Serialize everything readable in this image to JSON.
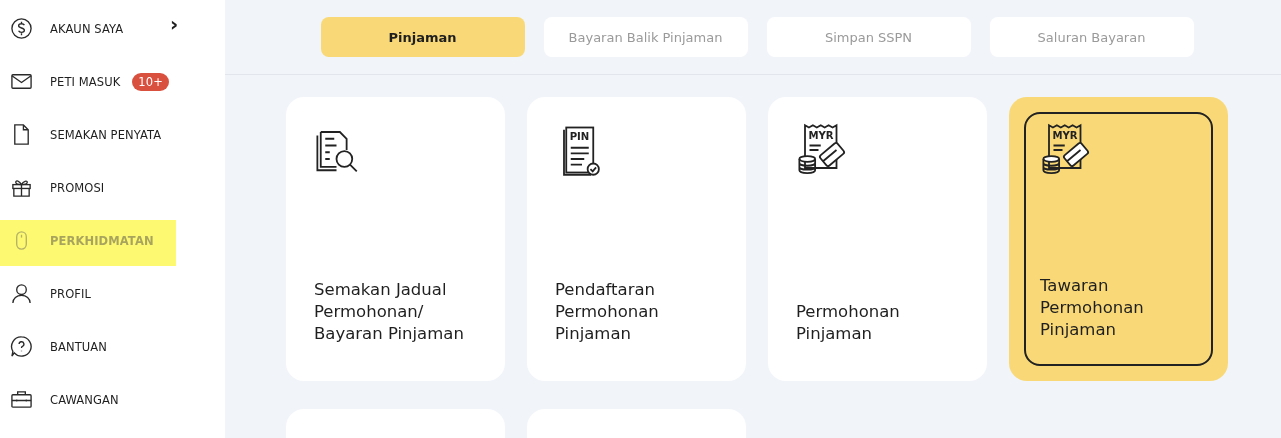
{
  "sidebar": {
    "items": [
      {
        "kind": "dollar",
        "label": "AKAUN SAYA",
        "chevron": "›",
        "selected": false
      },
      {
        "kind": "mail",
        "label": "PETI MASUK",
        "badge": "10+",
        "selected": false
      },
      {
        "kind": "document",
        "label": "SEMAKAN PENYATA",
        "selected": false
      },
      {
        "kind": "gift",
        "label": "PROMOSI",
        "selected": false
      },
      {
        "kind": "mouse",
        "label": "PERKHIDMATAN",
        "selected": true
      },
      {
        "kind": "person",
        "label": "PROFIL",
        "selected": false
      },
      {
        "kind": "help",
        "label": "BANTUAN",
        "selected": false
      },
      {
        "kind": "briefcase",
        "label": "CAWANGAN",
        "selected": false
      }
    ]
  },
  "tabs": [
    {
      "label": "Pinjaman",
      "selected": true
    },
    {
      "label": "Bayaran Balik Pinjaman",
      "selected": false
    },
    {
      "label": "Simpan SSPN",
      "selected": false
    },
    {
      "label": "Saluran Bayaran",
      "selected": false
    }
  ],
  "cards": [
    {
      "kind": "search-document",
      "title": "Semakan Jadual Permohonan/ Bayaran Pinjaman",
      "selected": false
    },
    {
      "kind": "pin-document",
      "icon_text": "PIN",
      "title": "Pendaftaran Permohonan Pinjaman",
      "selected": false
    },
    {
      "kind": "receipt",
      "icon_text": "MYR",
      "title": "Permohonan Pinjaman",
      "selected": false
    },
    {
      "kind": "receipt",
      "icon_text": "MYR",
      "title": "Tawaran Permohonan Pinjaman",
      "selected": true
    },
    {
      "kind": "blank",
      "selected": false
    },
    {
      "kind": "blank",
      "selected": false
    }
  ]
}
